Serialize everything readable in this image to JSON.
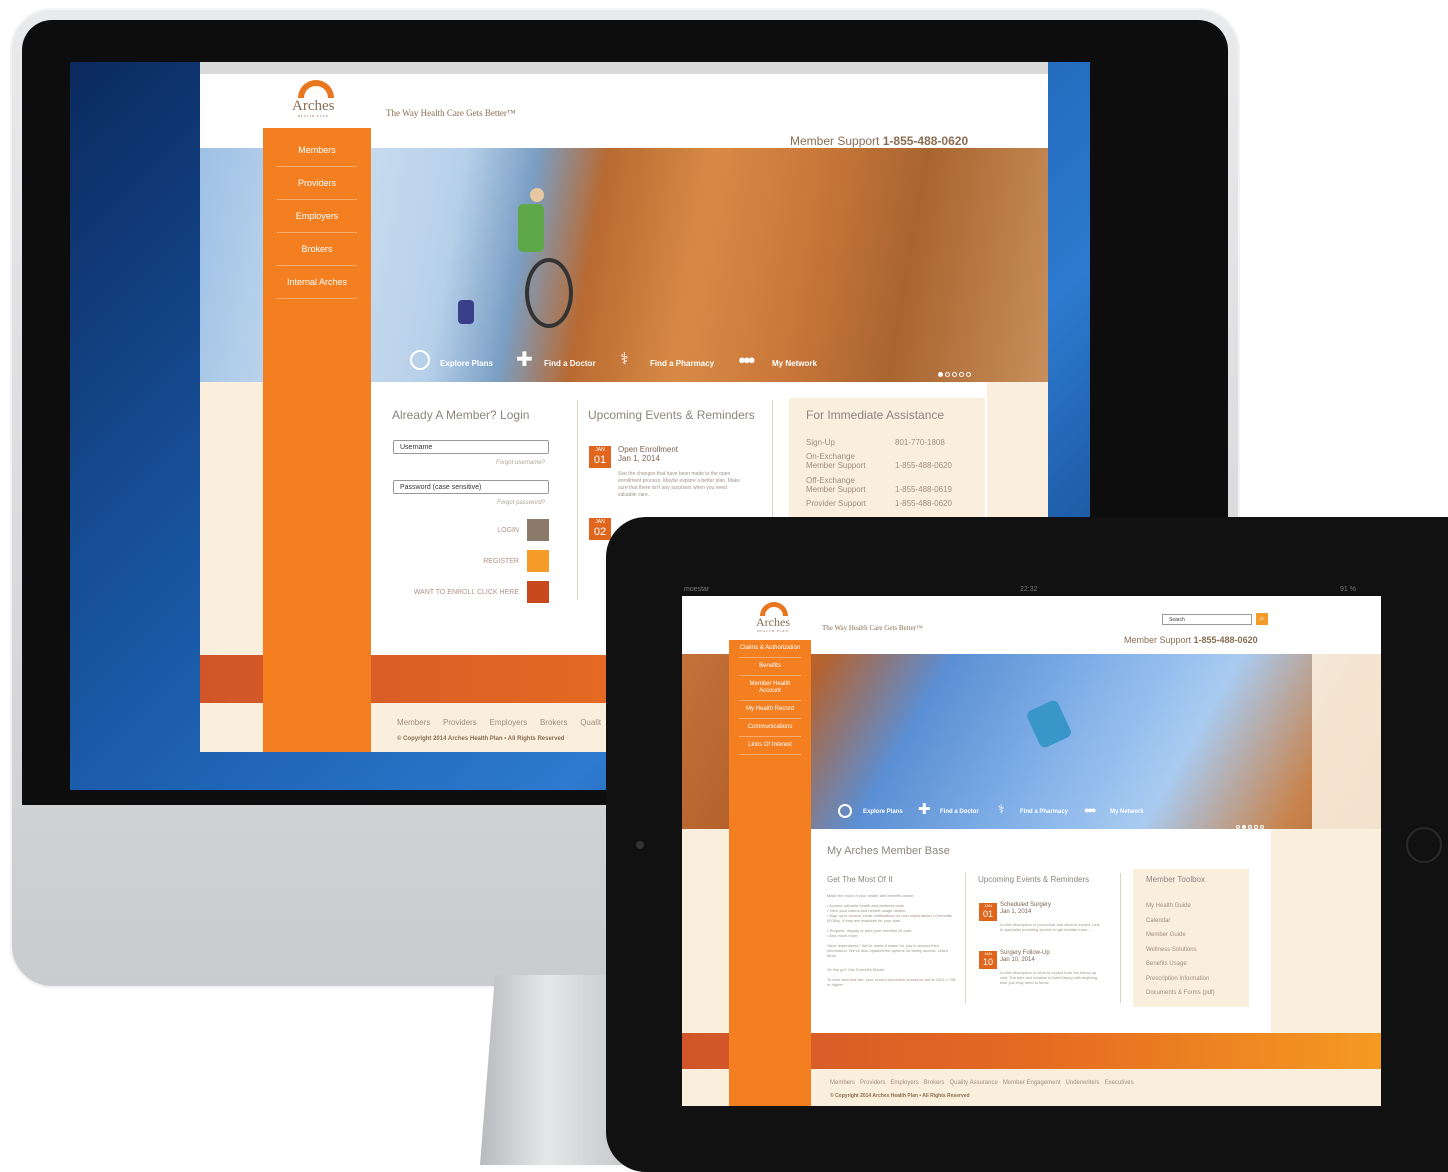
{
  "desktop": {
    "brand": {
      "name": "Arches",
      "subname": "HEALTH PLAN"
    },
    "tagline": "The Way Health Care Gets Better™",
    "support": {
      "label": "Member Support ",
      "phone": "1-855-488-0620"
    },
    "nav": [
      "Members",
      "Providers",
      "Employers",
      "Brokers",
      "Internal Arches"
    ],
    "hero_tools": [
      "Explore Plans",
      "Find a Doctor",
      "Find a Pharmacy",
      "My Network"
    ],
    "login": {
      "title": "Already A Member? Login",
      "username_placeholder": "Username",
      "forgot_username": "Forgot username?",
      "password_placeholder": "Password (case sensitive)",
      "forgot_password": "Forgot password?",
      "login_label": "LOGIN",
      "register_label": "REGISTER",
      "enroll_label": "WANT TO ENROLL CLICK HERE",
      "colors": {
        "login": "#8b7a6a",
        "register": "#f59b2a",
        "enroll": "#c9491e"
      }
    },
    "events": {
      "title": "Upcoming Events & Reminders",
      "items": [
        {
          "month": "JAN",
          "day": "01",
          "title": "Open Enrollment",
          "date": "Jan 1, 2014",
          "desc": "See the changes that have been made to the open enrollment process. Maybe explore a better plan. Make sure that there isn't any surprises when you need valuable care."
        },
        {
          "month": "JAN",
          "day": "02"
        }
      ]
    },
    "assistance": {
      "title": "For Immediate Assistance",
      "rows": [
        {
          "label": "Sign-Up",
          "phone": "801-770-1808"
        },
        {
          "label": "On-Exchange Member Support",
          "phone": "1-855-488-0620"
        },
        {
          "label": "Off-Exchange Member Support",
          "phone": "1-855-488-0619"
        },
        {
          "label": "Provider Support",
          "phone": "1-855-488-0620"
        }
      ]
    },
    "footer": {
      "links": [
        "Members",
        "Providers",
        "Employers",
        "Brokers",
        "Qualit"
      ],
      "copyright": "© Copyright 2014 Arches Health Plan • All Rights Reserved"
    }
  },
  "tablet": {
    "status": {
      "carrier": "moestar",
      "time": "22:32",
      "battery": "91 %"
    },
    "brand": {
      "name": "Arches",
      "subname": "HEALTH PLAN"
    },
    "tagline": "The Way Health Care Gets Better™",
    "search_placeholder": "Search",
    "support": {
      "label": "Member Support ",
      "phone": "1-855-488-0620"
    },
    "nav": [
      "Claims & Authorization",
      "Benefits",
      "Member Health Account",
      "My Health Record",
      "Communications",
      "Links Of Interest"
    ],
    "hero_tools": [
      "Explore Plans",
      "Find a Doctor",
      "Find a Pharmacy",
      "My Network"
    ],
    "page_title": "My Arches Member Base",
    "most": {
      "title": "Get The Most Of It",
      "intro": "Make the most of your health and benefits online:",
      "bullets": [
        "• Access valuable health and wellness tools",
        "• View your claims and benefit usage details",
        "• Sign up to receive email notifications for new explanations of benefits (EOBs), if they are available for your plan",
        "• Request, display or print your member ID card",
        "• And much more"
      ],
      "dependents": "Have dependents? We've made it easier for you to access their information. We've also updated the options for family access. Learn More",
      "mobile": "On the go? Use Everett's Mobile",
      "resolution": "To best view this site, your screen resolution should be set at 1024 x 768 or higher."
    },
    "events": {
      "title": "Upcoming Events & Reminders",
      "items": [
        {
          "month": "JAN",
          "day": "01",
          "title": "Scheduled Surgery",
          "date": "Jan 1, 2014",
          "desc": "A brief description of procedure and what to expect. Link to specialist providing service to get familiar more..."
        },
        {
          "month": "JAN",
          "day": "10",
          "title": "Surgery Follow-Up",
          "date": "Jan 10, 2014",
          "desc": "A brief description of what to expect from the follow-up visit. The time and location is listed along with anything else you may need to know."
        }
      ]
    },
    "toolbox": {
      "title": "Member Toolbox",
      "links": [
        "My Health Guide",
        "Calendar",
        "Member Guide",
        "Wellness Solutions",
        "Benefits Usage",
        "Prescription Information",
        "Documents & Forms (pdf)"
      ]
    },
    "footer": {
      "links": [
        "Members",
        "Providers",
        "Employers",
        "Brokers",
        "Quality Assurance",
        "Member Engagement",
        "Underwriters",
        "Executives"
      ],
      "copyright": "© Copyright 2014 Arches Health Plan • All Rights Reserved"
    }
  },
  "colors": {
    "brand_orange": "#f47f20",
    "cream": "#faeedd",
    "rust": "#d0562a",
    "text_brown": "#8a6d52"
  }
}
